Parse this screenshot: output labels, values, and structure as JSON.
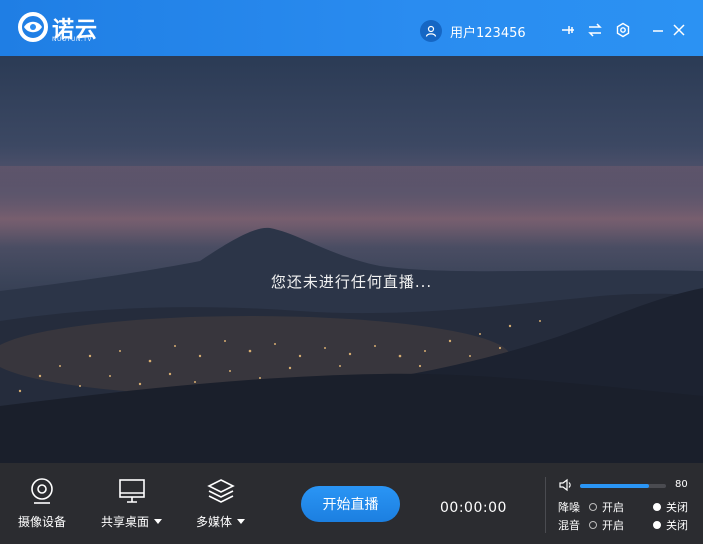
{
  "app": {
    "brand": "诺云",
    "brand_sub": "NUOYUN.TV"
  },
  "header": {
    "user_name": "用户123456",
    "icons": [
      "pin-icon",
      "switch-icon",
      "settings-icon",
      "minimize-icon",
      "close-icon"
    ]
  },
  "preview": {
    "status_text": "您还未进行任何直播..."
  },
  "controls": {
    "camera_label": "摄像设备",
    "share_label": "共享桌面",
    "media_label": "多媒体",
    "start_label": "开始直播",
    "timer": "00:00:00"
  },
  "audio": {
    "volume": 80,
    "volume_fraction": 0.8,
    "noise_label": "降噪",
    "mix_label": "混音",
    "on_label": "开启",
    "off_label": "关闭",
    "noise_selected": "关闭",
    "mix_selected": "关闭"
  },
  "colors": {
    "accent": "#2a95f5",
    "titlebar": "#2a8cf0",
    "bottom": "#2b2c30"
  }
}
